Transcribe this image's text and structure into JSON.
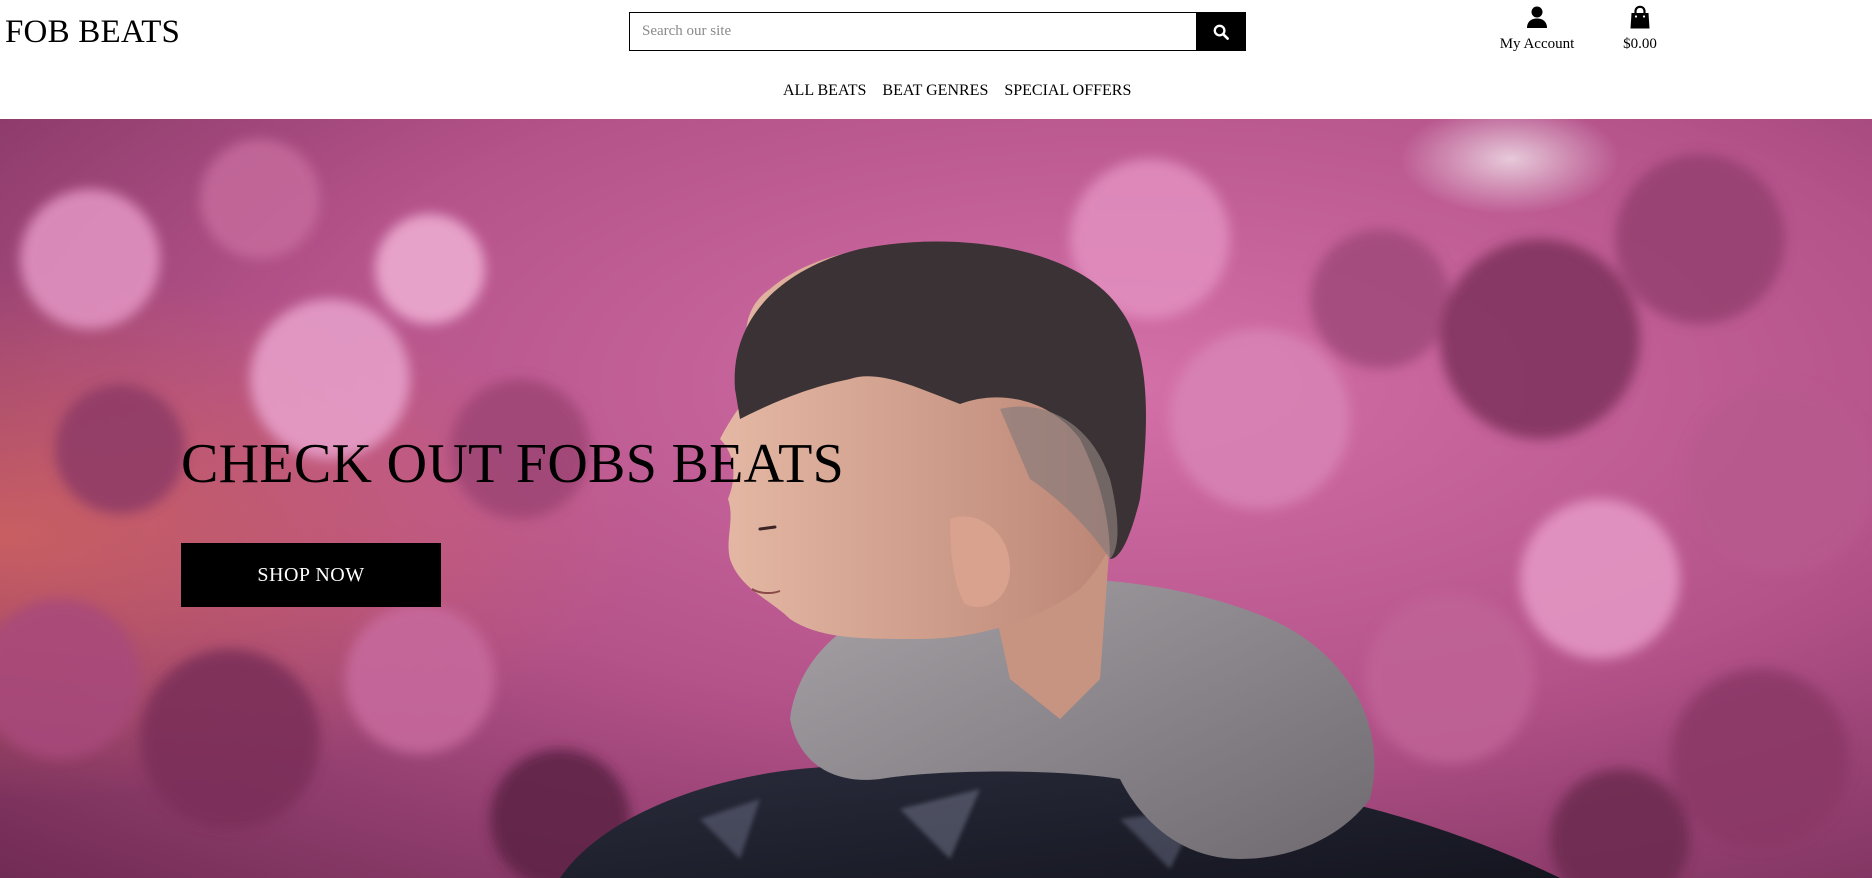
{
  "header": {
    "brand": "FOB BEATS",
    "search": {
      "placeholder": "Search our site",
      "value": "",
      "button_icon": "search-icon"
    },
    "account": {
      "label": "My Account",
      "icon": "user-icon"
    },
    "cart": {
      "total": "$0.00",
      "icon": "shopping-bag-icon"
    }
  },
  "nav": {
    "items": [
      {
        "label": "ALL BEATS"
      },
      {
        "label": "BEAT GENRES"
      },
      {
        "label": "SPECIAL OFFERS"
      }
    ]
  },
  "hero": {
    "title": "CHECK OUT FOBS BEATS",
    "button_label": "SHOP NOW"
  },
  "colors": {
    "text": "#000000",
    "background": "#ffffff",
    "button": "#000000",
    "button_text": "#ffffff",
    "hero_tint": "#b0457e"
  }
}
